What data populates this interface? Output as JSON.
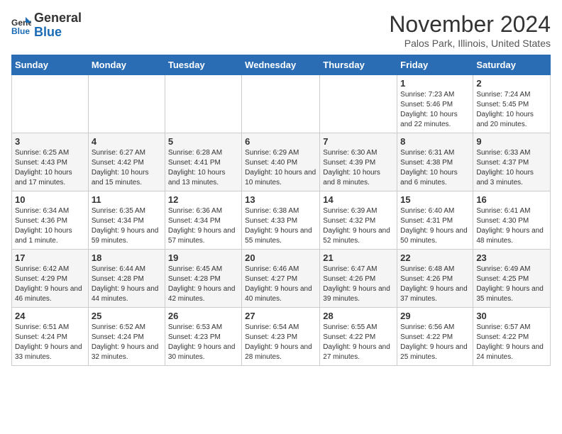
{
  "logo": {
    "line1": "General",
    "line2": "Blue"
  },
  "title": "November 2024",
  "subtitle": "Palos Park, Illinois, United States",
  "days_of_week": [
    "Sunday",
    "Monday",
    "Tuesday",
    "Wednesday",
    "Thursday",
    "Friday",
    "Saturday"
  ],
  "weeks": [
    [
      {
        "day": "",
        "detail": ""
      },
      {
        "day": "",
        "detail": ""
      },
      {
        "day": "",
        "detail": ""
      },
      {
        "day": "",
        "detail": ""
      },
      {
        "day": "",
        "detail": ""
      },
      {
        "day": "1",
        "detail": "Sunrise: 7:23 AM\nSunset: 5:46 PM\nDaylight: 10 hours and 22 minutes."
      },
      {
        "day": "2",
        "detail": "Sunrise: 7:24 AM\nSunset: 5:45 PM\nDaylight: 10 hours and 20 minutes."
      }
    ],
    [
      {
        "day": "3",
        "detail": "Sunrise: 6:25 AM\nSunset: 4:43 PM\nDaylight: 10 hours and 17 minutes."
      },
      {
        "day": "4",
        "detail": "Sunrise: 6:27 AM\nSunset: 4:42 PM\nDaylight: 10 hours and 15 minutes."
      },
      {
        "day": "5",
        "detail": "Sunrise: 6:28 AM\nSunset: 4:41 PM\nDaylight: 10 hours and 13 minutes."
      },
      {
        "day": "6",
        "detail": "Sunrise: 6:29 AM\nSunset: 4:40 PM\nDaylight: 10 hours and 10 minutes."
      },
      {
        "day": "7",
        "detail": "Sunrise: 6:30 AM\nSunset: 4:39 PM\nDaylight: 10 hours and 8 minutes."
      },
      {
        "day": "8",
        "detail": "Sunrise: 6:31 AM\nSunset: 4:38 PM\nDaylight: 10 hours and 6 minutes."
      },
      {
        "day": "9",
        "detail": "Sunrise: 6:33 AM\nSunset: 4:37 PM\nDaylight: 10 hours and 3 minutes."
      }
    ],
    [
      {
        "day": "10",
        "detail": "Sunrise: 6:34 AM\nSunset: 4:36 PM\nDaylight: 10 hours and 1 minute."
      },
      {
        "day": "11",
        "detail": "Sunrise: 6:35 AM\nSunset: 4:34 PM\nDaylight: 9 hours and 59 minutes."
      },
      {
        "day": "12",
        "detail": "Sunrise: 6:36 AM\nSunset: 4:34 PM\nDaylight: 9 hours and 57 minutes."
      },
      {
        "day": "13",
        "detail": "Sunrise: 6:38 AM\nSunset: 4:33 PM\nDaylight: 9 hours and 55 minutes."
      },
      {
        "day": "14",
        "detail": "Sunrise: 6:39 AM\nSunset: 4:32 PM\nDaylight: 9 hours and 52 minutes."
      },
      {
        "day": "15",
        "detail": "Sunrise: 6:40 AM\nSunset: 4:31 PM\nDaylight: 9 hours and 50 minutes."
      },
      {
        "day": "16",
        "detail": "Sunrise: 6:41 AM\nSunset: 4:30 PM\nDaylight: 9 hours and 48 minutes."
      }
    ],
    [
      {
        "day": "17",
        "detail": "Sunrise: 6:42 AM\nSunset: 4:29 PM\nDaylight: 9 hours and 46 minutes."
      },
      {
        "day": "18",
        "detail": "Sunrise: 6:44 AM\nSunset: 4:28 PM\nDaylight: 9 hours and 44 minutes."
      },
      {
        "day": "19",
        "detail": "Sunrise: 6:45 AM\nSunset: 4:28 PM\nDaylight: 9 hours and 42 minutes."
      },
      {
        "day": "20",
        "detail": "Sunrise: 6:46 AM\nSunset: 4:27 PM\nDaylight: 9 hours and 40 minutes."
      },
      {
        "day": "21",
        "detail": "Sunrise: 6:47 AM\nSunset: 4:26 PM\nDaylight: 9 hours and 39 minutes."
      },
      {
        "day": "22",
        "detail": "Sunrise: 6:48 AM\nSunset: 4:26 PM\nDaylight: 9 hours and 37 minutes."
      },
      {
        "day": "23",
        "detail": "Sunrise: 6:49 AM\nSunset: 4:25 PM\nDaylight: 9 hours and 35 minutes."
      }
    ],
    [
      {
        "day": "24",
        "detail": "Sunrise: 6:51 AM\nSunset: 4:24 PM\nDaylight: 9 hours and 33 minutes."
      },
      {
        "day": "25",
        "detail": "Sunrise: 6:52 AM\nSunset: 4:24 PM\nDaylight: 9 hours and 32 minutes."
      },
      {
        "day": "26",
        "detail": "Sunrise: 6:53 AM\nSunset: 4:23 PM\nDaylight: 9 hours and 30 minutes."
      },
      {
        "day": "27",
        "detail": "Sunrise: 6:54 AM\nSunset: 4:23 PM\nDaylight: 9 hours and 28 minutes."
      },
      {
        "day": "28",
        "detail": "Sunrise: 6:55 AM\nSunset: 4:22 PM\nDaylight: 9 hours and 27 minutes."
      },
      {
        "day": "29",
        "detail": "Sunrise: 6:56 AM\nSunset: 4:22 PM\nDaylight: 9 hours and 25 minutes."
      },
      {
        "day": "30",
        "detail": "Sunrise: 6:57 AM\nSunset: 4:22 PM\nDaylight: 9 hours and 24 minutes."
      }
    ]
  ]
}
